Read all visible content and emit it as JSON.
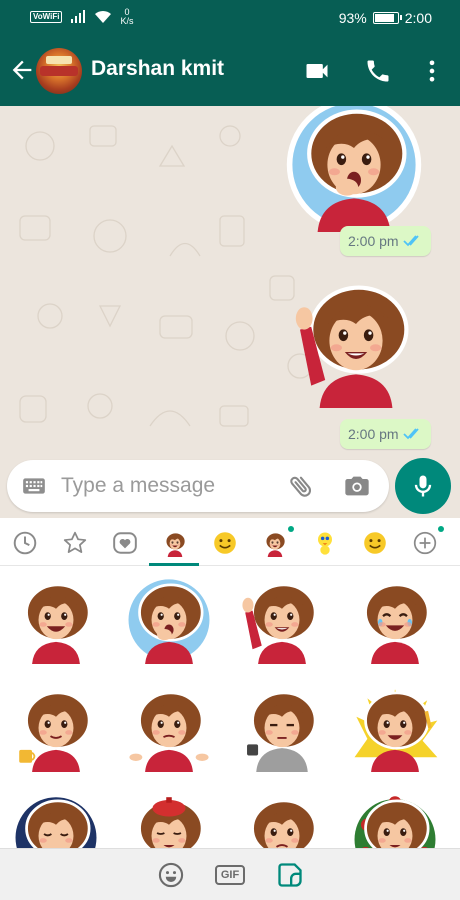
{
  "status_bar": {
    "network_badge": "VoWiFi",
    "net_speed_value": "0",
    "net_speed_unit": "K/s",
    "battery_text": "93%",
    "battery_level": 0.93,
    "time": "2:00"
  },
  "header": {
    "contact_name": "Darshan kmit",
    "icons": [
      "back-arrow-icon",
      "video-call-icon",
      "voice-call-icon",
      "more-options-icon"
    ]
  },
  "messages": [
    {
      "type": "sticker",
      "sticker": "girl-yawning",
      "time": "2:00 pm",
      "status": "read"
    },
    {
      "type": "sticker",
      "sticker": "girl-waving",
      "time": "2:00 pm",
      "status": "read"
    }
  ],
  "composer": {
    "placeholder": "Type a message",
    "icons": [
      "keyboard-icon",
      "attach-icon",
      "camera-icon",
      "mic-icon"
    ]
  },
  "sticker_tabs": [
    {
      "name": "recent",
      "icon": "clock-icon"
    },
    {
      "name": "favorites",
      "icon": "star-icon"
    },
    {
      "name": "love",
      "icon": "heart-icon"
    },
    {
      "name": "girl-pack",
      "icon": "girl-sticker-icon",
      "selected": true
    },
    {
      "name": "smiley-pack",
      "icon": "smiley-sticker-icon"
    },
    {
      "name": "girl-pack-2",
      "icon": "girl-sticker-icon",
      "new": true
    },
    {
      "name": "tweety-pack",
      "icon": "bird-sticker-icon"
    },
    {
      "name": "smiley-pack-2",
      "icon": "smiley-sticker-icon"
    },
    {
      "name": "add",
      "icon": "add-icon",
      "new": true
    }
  ],
  "stickers": [
    "girl-laughing",
    "girl-yawning",
    "girl-waving",
    "girl-crying-laughing",
    "girl-coffee",
    "girl-shrugging",
    "girl-tired-hoodie",
    "girl-celebrating",
    "girl-sleeping",
    "girl-sick",
    "girl-worried",
    "girl-roses"
  ],
  "bottom_bar": {
    "gif_label": "GIF",
    "icons": [
      "emoji-icon",
      "gif-icon",
      "sticker-icon"
    ]
  },
  "colors": {
    "primary": "#075e54",
    "accent": "#00897b",
    "bubble": "#dcf8c6",
    "chat_bg": "#ece5dd",
    "read_tick": "#4fc3f7",
    "hair": "#8a4a22",
    "sweater": "#c8243a"
  }
}
